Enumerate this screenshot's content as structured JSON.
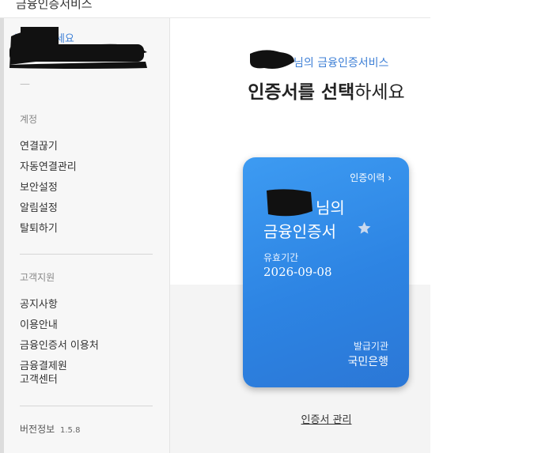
{
  "window": {
    "title": "금융인증서비스"
  },
  "sidebar": {
    "greeting": "님 안녕하세요",
    "dash": "—",
    "sections": [
      {
        "label": "계정",
        "items": [
          "연결끊기",
          "자동연결관리",
          "보안설정",
          "알림설정",
          "탈퇴하기"
        ]
      },
      {
        "label": "고객지원",
        "items": [
          "공지사항",
          "이용안내",
          "금융인증서 이용처",
          "금융결제원\n고객센터"
        ]
      }
    ],
    "version_label": "버전정보",
    "version_number": "1.5.8"
  },
  "main": {
    "subtitle": "님의 금융인증서비스",
    "heading_bold": "인증서를 선택",
    "heading_rest": "하세요",
    "manage_link": "인증서 관리"
  },
  "card": {
    "history_label": "인증이력 ›",
    "owner_suffix": "님의",
    "cert_name": "금융인증서",
    "valid_label": "유효기간",
    "valid_date": "2026-09-08",
    "issuer_label": "발급기관",
    "issuer": "국민은행",
    "star_icon": "star-icon"
  },
  "colors": {
    "accent": "#3d7fd6",
    "card_gradient_start": "#3d9bf2",
    "card_gradient_end": "#2b77d6",
    "sidebar_bg": "#f7f7f7"
  }
}
